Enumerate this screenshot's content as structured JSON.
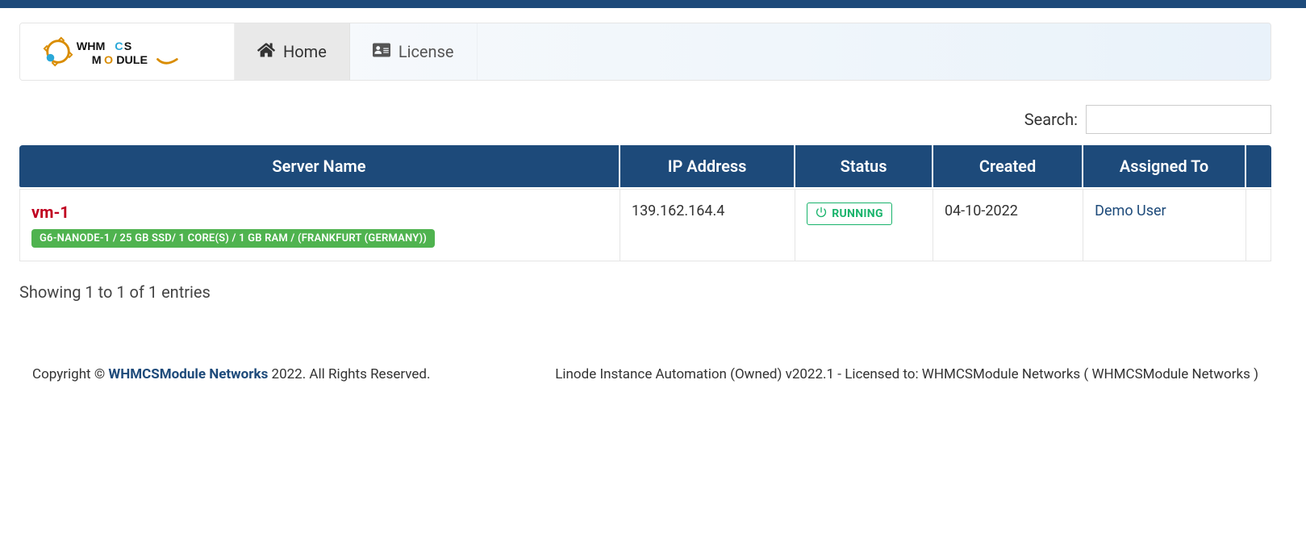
{
  "nav": {
    "tabs": [
      {
        "label": "Home"
      },
      {
        "label": "License"
      }
    ]
  },
  "search": {
    "label": "Search:",
    "value": ""
  },
  "table": {
    "headers": {
      "server_name": "Server Name",
      "ip_address": "IP Address",
      "status": "Status",
      "created": "Created",
      "assigned_to": "Assigned To"
    },
    "rows": [
      {
        "name": "vm-1",
        "spec": "G6-NANODE-1 / 25 GB SSD/ 1 CORE(S) / 1 GB RAM / (FRANKFURT (GERMANY))",
        "ip": "139.162.164.4",
        "status": "RUNNING",
        "created": "04-10-2022",
        "assigned_to": "Demo User"
      }
    ],
    "info": "Showing 1 to 1 of 1 entries"
  },
  "footer": {
    "left_prefix": "Copyright © ",
    "brand": "WHMCSModule Networks",
    "left_suffix": " 2022. All Rights Reserved.",
    "right": "Linode Instance Automation (Owned) v2022.1 - Licensed to: WHMCSModule Networks ( WHMCSModule Networks )"
  }
}
